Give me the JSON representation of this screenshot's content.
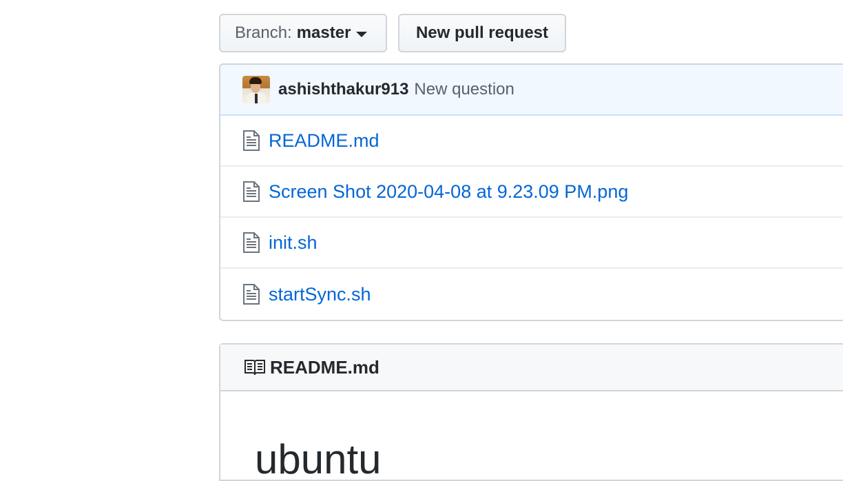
{
  "toolbar": {
    "branch_prefix": "Branch:",
    "branch_name": "master",
    "new_pull_request_label": "New pull request"
  },
  "commit": {
    "author": "ashishthakur913",
    "message": "New question"
  },
  "files": [
    {
      "name": "README.md",
      "icon": "file-icon"
    },
    {
      "name": "Screen Shot 2020-04-08 at 9.23.09 PM.png",
      "icon": "file-icon"
    },
    {
      "name": "init.sh",
      "icon": "file-icon"
    },
    {
      "name": "startSync.sh",
      "icon": "file-icon"
    }
  ],
  "readme": {
    "icon": "book-icon",
    "title": "README.md",
    "heading": "ubuntu"
  },
  "colors": {
    "link": "#0366d6",
    "commit_bar_bg": "#f1f8ff",
    "border": "#d1d5da"
  }
}
